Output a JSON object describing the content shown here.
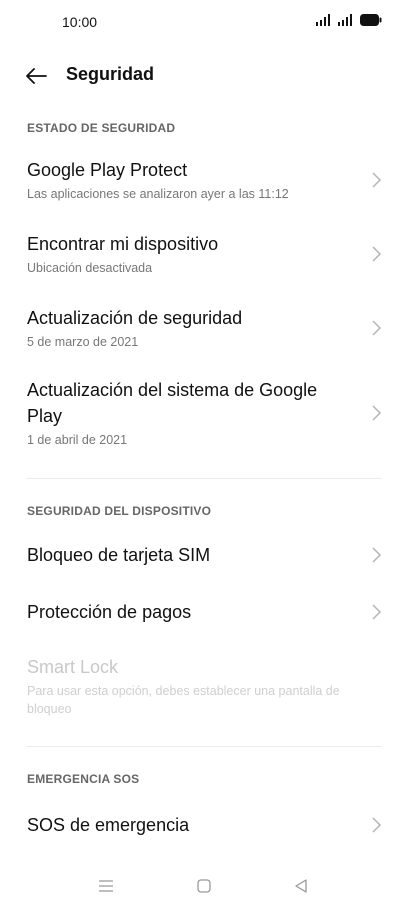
{
  "status_bar": {
    "time": "10:00",
    "icons": [
      "signal-icon",
      "signal-icon",
      "battery-icon"
    ]
  },
  "app_bar": {
    "title": "Seguridad",
    "back_icon": "arrow-left-icon"
  },
  "sections": {
    "estado": {
      "header": "ESTADO DE SEGURIDAD",
      "items": [
        {
          "title": "Google Play Protect",
          "subtitle": "Las aplicaciones se analizaron ayer a las 11:12"
        },
        {
          "title": "Encontrar mi dispositivo",
          "subtitle": "Ubicación desactivada"
        },
        {
          "title": "Actualización de seguridad",
          "subtitle": "5 de marzo de 2021"
        },
        {
          "title_line1": "Actualización del sistema de Google",
          "title_line2": "Play",
          "subtitle": "1 de abril de 2021"
        }
      ]
    },
    "dispositivo": {
      "header": "SEGURIDAD DEL DISPOSITIVO",
      "items": [
        {
          "title": "Bloqueo de tarjeta SIM"
        },
        {
          "title": "Protección de pagos"
        },
        {
          "title": "Smart Lock",
          "subtitle_line1": "Para usar esta opción, debes establecer una pantalla de",
          "subtitle_line2": "bloqueo"
        }
      ]
    },
    "sos": {
      "header": "EMERGENCIA SOS",
      "items": [
        {
          "title": "SOS de emergencia"
        }
      ]
    }
  },
  "nav_bar": {
    "icons": [
      "menu-icon",
      "home-icon",
      "back-triangle-icon"
    ]
  }
}
